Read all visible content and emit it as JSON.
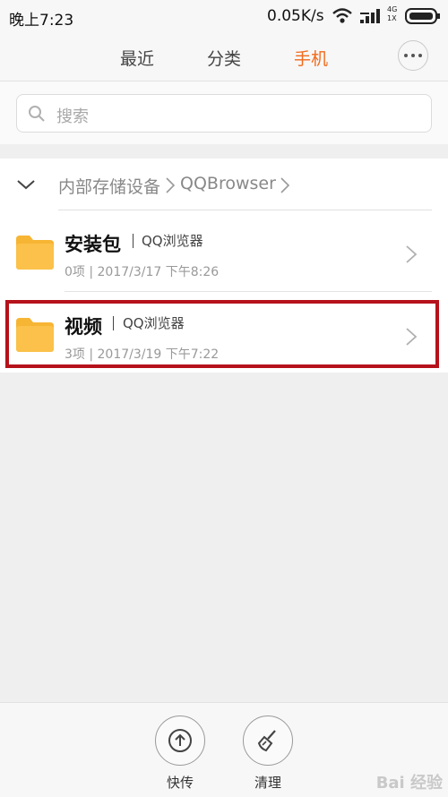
{
  "status_bar": {
    "time": "晚上7:23",
    "net_speed": "0.05K/s",
    "signal_label": "4G",
    "signal_sub": "1X",
    "icons": [
      "wifi-icon",
      "signal-icon",
      "battery-icon"
    ]
  },
  "tabs": [
    {
      "label": "最近",
      "active": false
    },
    {
      "label": "分类",
      "active": false
    },
    {
      "label": "手机",
      "active": true
    }
  ],
  "accent_color": "#f26a1b",
  "search": {
    "placeholder": "搜索"
  },
  "breadcrumb": {
    "items": [
      "内部存储设备",
      "QQBrowser"
    ]
  },
  "folders": [
    {
      "name": "安装包",
      "tag": "QQ浏览器",
      "meta": "0项 | 2017/3/17 下午8:26",
      "highlighted": false
    },
    {
      "name": "视频",
      "tag": "QQ浏览器",
      "meta": "3项 | 2017/3/19 下午7:22",
      "highlighted": true
    }
  ],
  "highlight_color": "#b5121b",
  "bottom_bar": {
    "actions": [
      {
        "label": "快传",
        "icon": "upload-arrow-icon"
      },
      {
        "label": "清理",
        "icon": "broom-icon"
      }
    ]
  },
  "watermark": "Bai 经验"
}
